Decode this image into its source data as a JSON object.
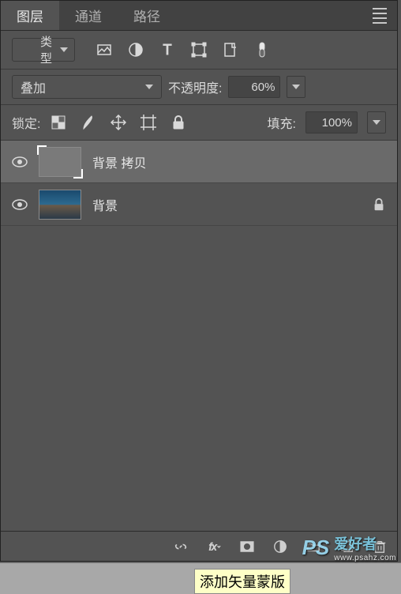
{
  "tabs": {
    "layers": "图层",
    "channels": "通道",
    "paths": "路径"
  },
  "filter": {
    "type_label": "类型",
    "search_icon": "search-icon"
  },
  "blend": {
    "mode": "叠加",
    "opacity_label": "不透明度:",
    "opacity_value": "60%"
  },
  "lock": {
    "label": "锁定:",
    "fill_label": "填充:",
    "fill_value": "100%"
  },
  "layers_list": [
    {
      "name": "背景 拷贝",
      "selected": true,
      "visible": true,
      "locked": false,
      "thumb": "gray"
    },
    {
      "name": "背景",
      "selected": false,
      "visible": true,
      "locked": true,
      "thumb": "image"
    }
  ],
  "tooltip": "添加矢量蒙版",
  "watermark": {
    "brand": "PS",
    "zh": "爱好者",
    "url": "www.psahz.com"
  }
}
